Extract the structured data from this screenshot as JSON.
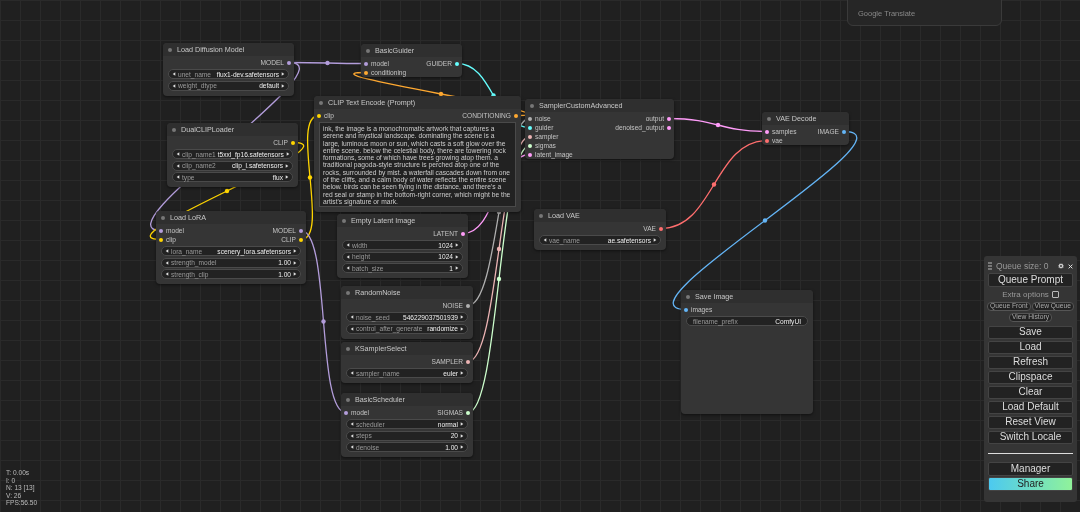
{
  "translate_popup": {
    "label": "Google Translate"
  },
  "nodes": [
    {
      "title": "Load Diffusion Model",
      "outputs": [
        {
          "name": "MODEL",
          "color": "#b39ddb"
        }
      ],
      "widgets": [
        {
          "name": "unet_name",
          "value": "flux1-dev.safetensors",
          "kind": "combo"
        },
        {
          "name": "weight_dtype",
          "value": "default",
          "kind": "combo"
        }
      ]
    },
    {
      "title": "BasicGuider",
      "inputs": [
        {
          "name": "model",
          "color": "#b39ddb"
        },
        {
          "name": "conditioning",
          "color": "#ffa931"
        }
      ],
      "outputs": [
        {
          "name": "GUIDER",
          "color": "#66ffff"
        }
      ]
    },
    {
      "title": "DualCLIPLoader",
      "outputs": [
        {
          "name": "CLIP",
          "color": "#ffd500"
        }
      ],
      "widgets": [
        {
          "name": "clip_name1",
          "value": "t5xxl_fp16.safetensors",
          "kind": "combo"
        },
        {
          "name": "clip_name2",
          "value": "clip_l.safetensors",
          "kind": "combo"
        },
        {
          "name": "type",
          "value": "flux",
          "kind": "combo"
        }
      ]
    },
    {
      "title": "CLIP Text Encode (Prompt)",
      "inputs": [
        {
          "name": "clip",
          "color": "#ffd500"
        }
      ],
      "outputs": [
        {
          "name": "CONDITIONING",
          "color": "#ffa931"
        }
      ],
      "prompt": "ink, the image is a monochromatic artwork that captures a serene and mystical landscape. dominating the scene is a large, luminous moon or sun, which casts a soft glow over the entire scene. below the celestial body, there are towering rock formations, some of which have trees growing atop them. a traditional pagoda-style structure is perched atop one of the rocks, surrounded by mist. a waterfall cascades down from one of the cliffs, and a calm body of water reflects the entire scene below. birds can be seen flying in the distance, and there's a red seal or stamp in the bottom-right corner, which might be the artist's signature or mark."
    },
    {
      "title": "Load LoRA",
      "inputs": [
        {
          "name": "model",
          "color": "#b39ddb"
        },
        {
          "name": "clip",
          "color": "#ffd500"
        }
      ],
      "outputs": [
        {
          "name": "MODEL",
          "color": "#b39ddb"
        },
        {
          "name": "CLIP",
          "color": "#ffd500"
        }
      ],
      "widgets": [
        {
          "name": "lora_name",
          "value": "scenery_lora.safetensors",
          "kind": "combo"
        },
        {
          "name": "strength_model",
          "value": "1.00",
          "kind": "number"
        },
        {
          "name": "strength_clip",
          "value": "1.00",
          "kind": "number"
        }
      ]
    },
    {
      "title": "Empty Latent Image",
      "outputs": [
        {
          "name": "LATENT",
          "color": "#ff9cf9"
        }
      ],
      "widgets": [
        {
          "name": "width",
          "value": "1024",
          "kind": "number"
        },
        {
          "name": "height",
          "value": "1024",
          "kind": "number"
        },
        {
          "name": "batch_size",
          "value": "1",
          "kind": "number"
        }
      ]
    },
    {
      "title": "SamplerCustomAdvanced",
      "inputs": [
        {
          "name": "noise",
          "color": "#b0b0b0"
        },
        {
          "name": "guider",
          "color": "#66ffff"
        },
        {
          "name": "sampler",
          "color": "#ecb4b4"
        },
        {
          "name": "sigmas",
          "color": "#cdffcd"
        },
        {
          "name": "latent_image",
          "color": "#ff9cf9"
        }
      ],
      "outputs": [
        {
          "name": "output",
          "color": "#ff9cf9"
        },
        {
          "name": "denoised_output",
          "color": "#ff9cf9"
        }
      ]
    },
    {
      "title": "VAE Decode",
      "inputs": [
        {
          "name": "samples",
          "color": "#ff9cf9"
        },
        {
          "name": "vae",
          "color": "#ff6e6e"
        }
      ],
      "outputs": [
        {
          "name": "IMAGE",
          "color": "#64b5f6"
        }
      ]
    },
    {
      "title": "Load VAE",
      "outputs": [
        {
          "name": "VAE",
          "color": "#ff6e6e"
        }
      ],
      "widgets": [
        {
          "name": "vae_name",
          "value": "ae.safetensors",
          "kind": "combo"
        }
      ]
    },
    {
      "title": "RandomNoise",
      "outputs": [
        {
          "name": "NOISE",
          "color": "#b0b0b0"
        }
      ],
      "widgets": [
        {
          "name": "noise_seed",
          "value": "546229037501939",
          "kind": "number"
        },
        {
          "name": "control_after_generate",
          "value": "randomize",
          "kind": "combo"
        }
      ]
    },
    {
      "title": "KSamplerSelect",
      "outputs": [
        {
          "name": "SAMPLER",
          "color": "#ecb4b4"
        }
      ],
      "widgets": [
        {
          "name": "sampler_name",
          "value": "euler",
          "kind": "combo"
        }
      ]
    },
    {
      "title": "BasicScheduler",
      "inputs": [
        {
          "name": "model",
          "color": "#b39ddb"
        }
      ],
      "outputs": [
        {
          "name": "SIGMAS",
          "color": "#cdffcd"
        }
      ],
      "widgets": [
        {
          "name": "scheduler",
          "value": "normal",
          "kind": "combo"
        },
        {
          "name": "steps",
          "value": "20",
          "kind": "number"
        },
        {
          "name": "denoise",
          "value": "1.00",
          "kind": "number"
        }
      ]
    },
    {
      "title": "Save Image",
      "inputs": [
        {
          "name": "images",
          "color": "#64b5f6"
        }
      ],
      "widgets": [
        {
          "name": "filename_prefix",
          "value": "ComfyUI",
          "kind": "text"
        }
      ]
    }
  ],
  "canvas_stats": [
    "T: 0.00s",
    "I: 0",
    "N: 13 [13]",
    "V: 26",
    "FPS:56.50"
  ],
  "panel": {
    "queue_size": "Queue size: 0",
    "queue_button": "Queue Prompt",
    "extra_options": {
      "label": "Extra options",
      "checked": false
    },
    "small_buttons": [
      "Queue Front",
      "View Queue",
      "View History"
    ],
    "buttons": [
      "Save",
      "Load",
      "Refresh",
      "Clipspace",
      "Clear",
      "Load Default",
      "Reset View",
      "Switch Locale"
    ],
    "bottom_buttons": [
      {
        "label": "Manager",
        "kind": "plain"
      },
      {
        "label": "Share",
        "kind": "gradient"
      }
    ]
  }
}
